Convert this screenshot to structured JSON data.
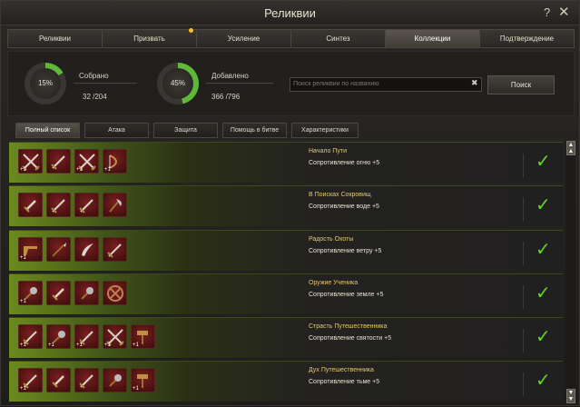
{
  "window": {
    "title": "Реликвии",
    "help_label": "?",
    "close_label": "✕"
  },
  "tabs": [
    {
      "label": "Реликвии"
    },
    {
      "label": "Призвать"
    },
    {
      "label": "Усиление"
    },
    {
      "label": "Синтез"
    },
    {
      "label": "Коллекции"
    },
    {
      "label": "Подтверждение"
    }
  ],
  "stats": {
    "collected": {
      "percent_label": "15%",
      "label": "Собрано",
      "count": "32 /204",
      "fraction": 0.16
    },
    "added": {
      "percent_label": "45%",
      "label": "Добавлено",
      "count": "366 /796",
      "fraction": 0.46
    }
  },
  "search": {
    "placeholder": "Поиск реликвии по названию",
    "clear_label": "✖",
    "button_label": "Поиск"
  },
  "filters": [
    {
      "label": "Полный список"
    },
    {
      "label": "Атака"
    },
    {
      "label": "Защита"
    },
    {
      "label": "Помощь в битве"
    },
    {
      "label": "Характеристики"
    }
  ],
  "collections": [
    {
      "name": "Начало Пути",
      "effect": "Сопротивление огню +5",
      "icons": [
        {
          "type": "crossed-swords-icon",
          "plus": "+1"
        },
        {
          "type": "sword-icon",
          "plus": ""
        },
        {
          "type": "crossed-swords-icon",
          "plus": "+1"
        },
        {
          "type": "bow-icon",
          "plus": "+1"
        }
      ]
    },
    {
      "name": "В Поисках Сокровищ",
      "effect": "Сопротивление воде +5",
      "icons": [
        {
          "type": "dagger-icon",
          "plus": ""
        },
        {
          "type": "sword-icon",
          "plus": ""
        },
        {
          "type": "sword-icon",
          "plus": ""
        },
        {
          "type": "axe-icon",
          "plus": ""
        }
      ]
    },
    {
      "name": "Радость Охоты",
      "effect": "Сопротивление ветру +5",
      "icons": [
        {
          "type": "gun-icon",
          "plus": "+1"
        },
        {
          "type": "spear-icon",
          "plus": ""
        },
        {
          "type": "scimitar-icon",
          "plus": ""
        },
        {
          "type": "sword-icon",
          "plus": ""
        }
      ]
    },
    {
      "name": "Оружие Ученика",
      "effect": "Сопротивление земле +5",
      "icons": [
        {
          "type": "mace-icon",
          "plus": "+1"
        },
        {
          "type": "dagger-icon",
          "plus": ""
        },
        {
          "type": "mace-icon",
          "plus": ""
        },
        {
          "type": "shield-icon",
          "plus": ""
        }
      ]
    },
    {
      "name": "Страсть Путешественника",
      "effect": "Сопротивление святости +5",
      "icons": [
        {
          "type": "sword-icon",
          "plus": "+1"
        },
        {
          "type": "mace-icon",
          "plus": "+1"
        },
        {
          "type": "sword-icon",
          "plus": "+1"
        },
        {
          "type": "crossed-swords-icon",
          "plus": "+1"
        },
        {
          "type": "hammer-icon",
          "plus": "+1"
        }
      ]
    },
    {
      "name": "Дух Путешественника",
      "effect": "Сопротивление тьме +5",
      "icons": [
        {
          "type": "sword-icon",
          "plus": "+1"
        },
        {
          "type": "dagger-icon",
          "plus": ""
        },
        {
          "type": "sword-icon",
          "plus": ""
        },
        {
          "type": "mace-icon",
          "plus": ""
        },
        {
          "type": "hammer-icon",
          "plus": "+1"
        }
      ]
    }
  ],
  "colors": {
    "accent_green": "#64d228",
    "ring_progress": "#5fb83a",
    "name_gold": "#e4c86a"
  }
}
